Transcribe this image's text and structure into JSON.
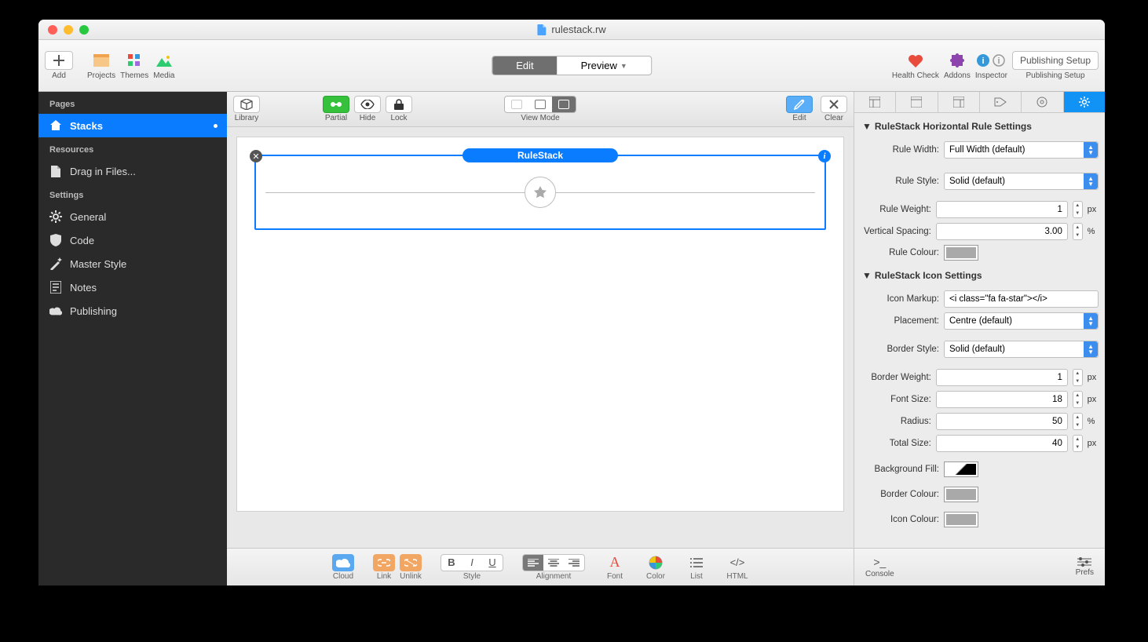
{
  "window": {
    "title": "rulestack.rw"
  },
  "toolbar": {
    "add": "Add",
    "projects": "Projects",
    "themes": "Themes",
    "media": "Media",
    "edit": "Edit",
    "preview": "Preview",
    "health": "Health Check",
    "addons": "Addons",
    "inspector": "Inspector",
    "publishing_setup": "Publishing Setup"
  },
  "sidebar": {
    "pages": "Pages",
    "resources": "Resources",
    "settings": "Settings",
    "stacks": "Stacks",
    "drag": "Drag in Files...",
    "general": "General",
    "code": "Code",
    "master": "Master Style",
    "notes": "Notes",
    "publishing": "Publishing"
  },
  "canvasToolbar": {
    "library": "Library",
    "partial": "Partial",
    "hide": "Hide",
    "lock": "Lock",
    "viewmode": "View Mode",
    "edit": "Edit",
    "clear": "Clear"
  },
  "stack": {
    "name": "RuleStack"
  },
  "canvasBottom": {
    "cloud": "Cloud",
    "link": "Link",
    "unlink": "Unlink",
    "style": "Style",
    "alignment": "Alignment",
    "font": "Font",
    "color": "Color",
    "list": "List",
    "html": "HTML"
  },
  "inspector": {
    "sec1": "RuleStack Horizontal Rule Settings",
    "sec2": "RuleStack Icon Settings",
    "labels": {
      "ruleWidth": "Rule Width:",
      "ruleStyle": "Rule Style:",
      "ruleWeight": "Rule Weight:",
      "vspacing": "Vertical Spacing:",
      "ruleColour": "Rule Colour:",
      "iconMarkup": "Icon Markup:",
      "placement": "Placement:",
      "borderStyle": "Border Style:",
      "borderWeight": "Border Weight:",
      "fontSize": "Font Size:",
      "radius": "Radius:",
      "totalSize": "Total Size:",
      "bgFill": "Background Fill:",
      "borderColour": "Border Colour:",
      "iconColour": "Icon Colour:"
    },
    "values": {
      "ruleWidth": "Full Width (default)",
      "ruleStyle": "Solid (default)",
      "ruleWeight": "1",
      "vspacing": "3.00",
      "iconMarkup": "<i class=\"fa fa-star\"></i>",
      "placement": "Centre (default)",
      "borderStyle": "Solid (default)",
      "borderWeight": "1",
      "fontSize": "18",
      "radius": "50",
      "totalSize": "40"
    },
    "units": {
      "px": "px",
      "pct": "%"
    },
    "bottom": {
      "console": "Console",
      "prefs": "Prefs"
    }
  }
}
